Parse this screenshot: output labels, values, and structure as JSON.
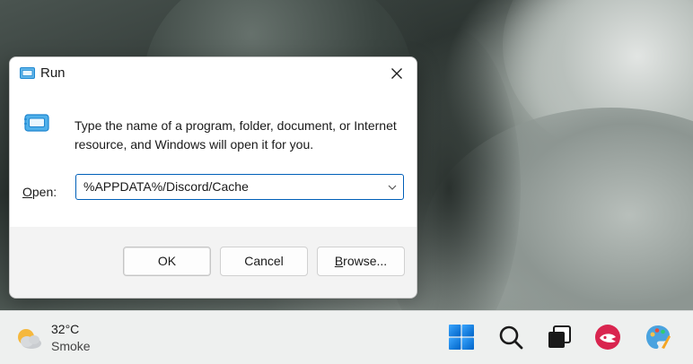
{
  "dialog": {
    "title": "Run",
    "description": "Type the name of a program, folder, document, or Internet resource, and Windows will open it for you.",
    "open_label_underlined": "O",
    "open_label_rest": "pen:",
    "open_value": "%APPDATA%/Discord/Cache",
    "ok_label": "OK",
    "cancel_label": "Cancel",
    "browse_label_underlined": "B",
    "browse_label_rest": "rowse..."
  },
  "taskbar": {
    "weather": {
      "temp": "32°C",
      "condition": "Smoke",
      "icon": "partly-cloudy-icon"
    },
    "icons": [
      "windows-start-icon",
      "search-icon",
      "task-view-icon",
      "app-icon",
      "paint-icon"
    ]
  },
  "colors": {
    "accent": "#005fb8",
    "start_blue": "#0078d4"
  }
}
